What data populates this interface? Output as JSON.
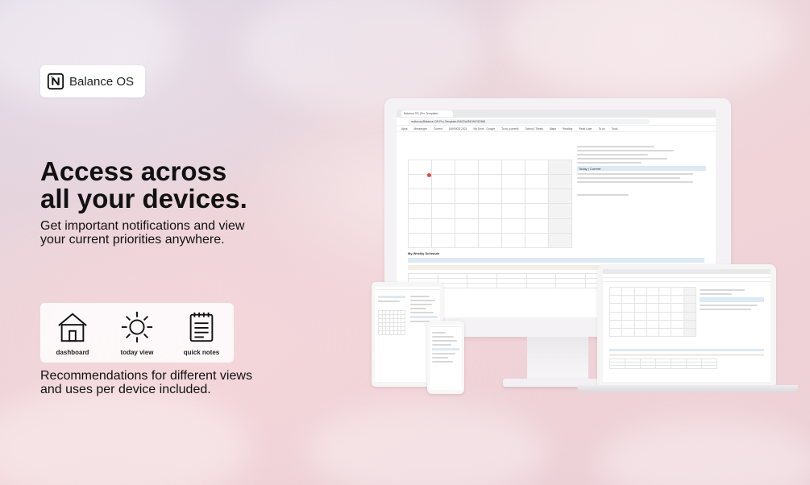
{
  "brand": {
    "name": "Balance OS",
    "logo_icon": "notion-logo-icon"
  },
  "headline": {
    "line1": "Access across",
    "line2": "all your devices."
  },
  "subline": {
    "line1": "Get important notifications and view",
    "line2": "your current priorities anywhere."
  },
  "views": [
    {
      "label": "dashboard",
      "icon": "house-icon"
    },
    {
      "label": "today view",
      "icon": "sun-icon"
    },
    {
      "label": "quick notes",
      "icon": "notepad-icon"
    }
  ],
  "recommendation": {
    "line1": "Recommendations for different views",
    "line2": "and uses per device included."
  },
  "monitor": {
    "tab_title": "Balance OS (Pro Template)",
    "url": "notion.so/Balance-OS-Pro-Template-ff1622a351094762966",
    "bookmarks": [
      "Apps",
      "Messenger",
      "Current",
      "SAVINGS 2021",
      "My Drive - Google",
      "To do (current)",
      "School | Thesis",
      "Maps",
      "Reading",
      "Read Later",
      "To do",
      "Tools"
    ],
    "section_today": "Today | Current",
    "section_weekly": "My Weekly Schedule"
  },
  "colors": {
    "accent_blue": "#dde9f3",
    "today_marker": "#e04a3b"
  }
}
